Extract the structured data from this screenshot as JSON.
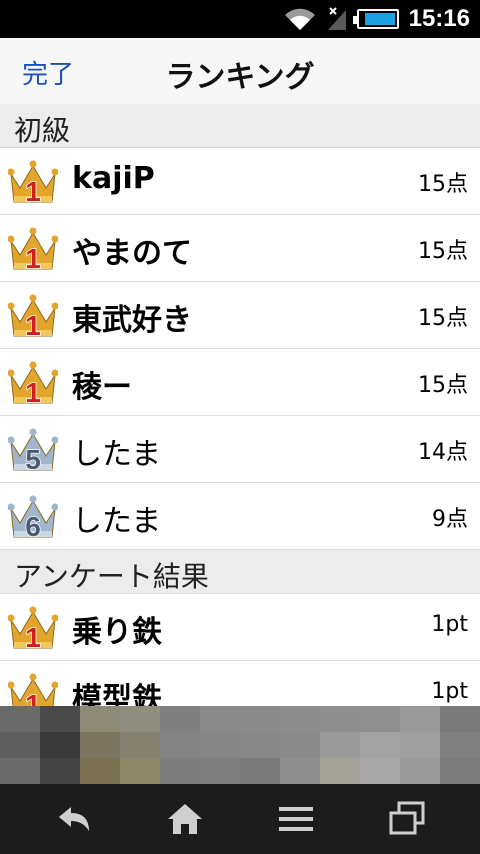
{
  "status": {
    "time": "15:16"
  },
  "header": {
    "done_label": "完了",
    "title": "ランキング"
  },
  "sections": [
    {
      "title": "初級",
      "rows": [
        {
          "rank": "1",
          "name": "kajiP",
          "score": "15点"
        },
        {
          "rank": "1",
          "name": "やまのて",
          "score": "15点"
        },
        {
          "rank": "1",
          "name": "東武好き",
          "score": "15点"
        },
        {
          "rank": "1",
          "name": "稜ー",
          "score": "15点"
        },
        {
          "rank": "5",
          "name": "したま",
          "score": "14点"
        },
        {
          "rank": "6",
          "name": "したま",
          "score": "9点"
        }
      ]
    },
    {
      "title": "アンケート結果",
      "rows": [
        {
          "rank": "1",
          "name": "乗り鉄",
          "score": "1pt"
        },
        {
          "rank": "1",
          "name": "模型鉄",
          "score": "1pt"
        }
      ]
    }
  ],
  "nav": {
    "back_icon": "back-arrow-icon",
    "home_icon": "home-icon",
    "menu_icon": "menu-icon",
    "recent_icon": "recent-apps-icon"
  },
  "colors": {
    "gold_crown": "#e3a52c",
    "silver_crown": "#9fb6cc",
    "rank_red": "#d11f1f",
    "done_blue": "#1a4fb8"
  }
}
